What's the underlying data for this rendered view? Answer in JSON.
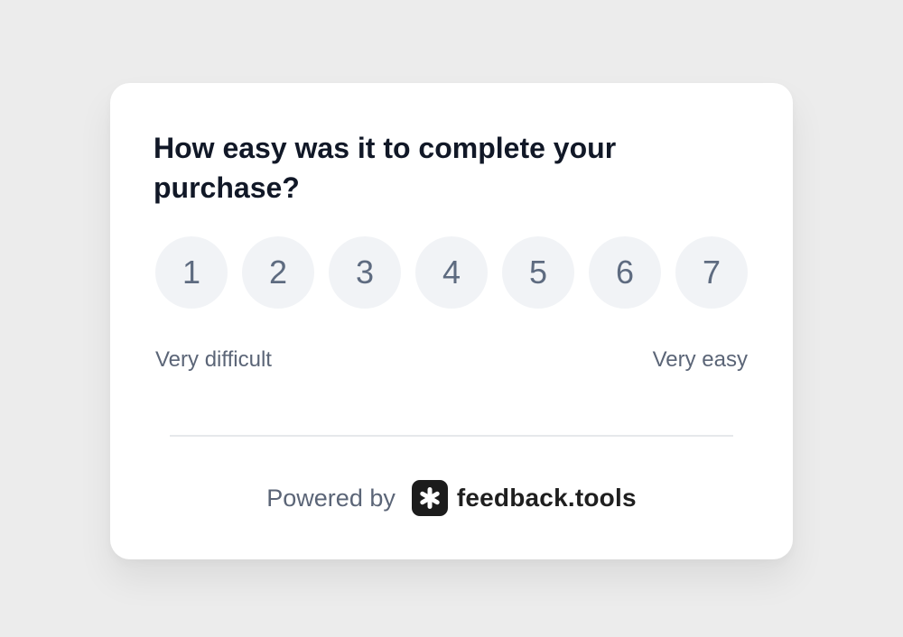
{
  "question": "How easy was it to complete your purchase?",
  "scale": {
    "options": [
      "1",
      "2",
      "3",
      "4",
      "5",
      "6",
      "7"
    ],
    "low_label": "Very difficult",
    "high_label": "Very easy"
  },
  "footer": {
    "powered_by": "Powered by",
    "brand_name": "feedback.tools",
    "brand_icon": "asterisk-logo-icon"
  },
  "colors": {
    "background": "#ececec",
    "card": "#ffffff",
    "question_text": "#111827",
    "scale_button_bg": "#f1f3f6",
    "scale_button_text": "#5e6b80",
    "secondary_text": "#5b6577",
    "logo_bg": "#1c1c1c"
  }
}
